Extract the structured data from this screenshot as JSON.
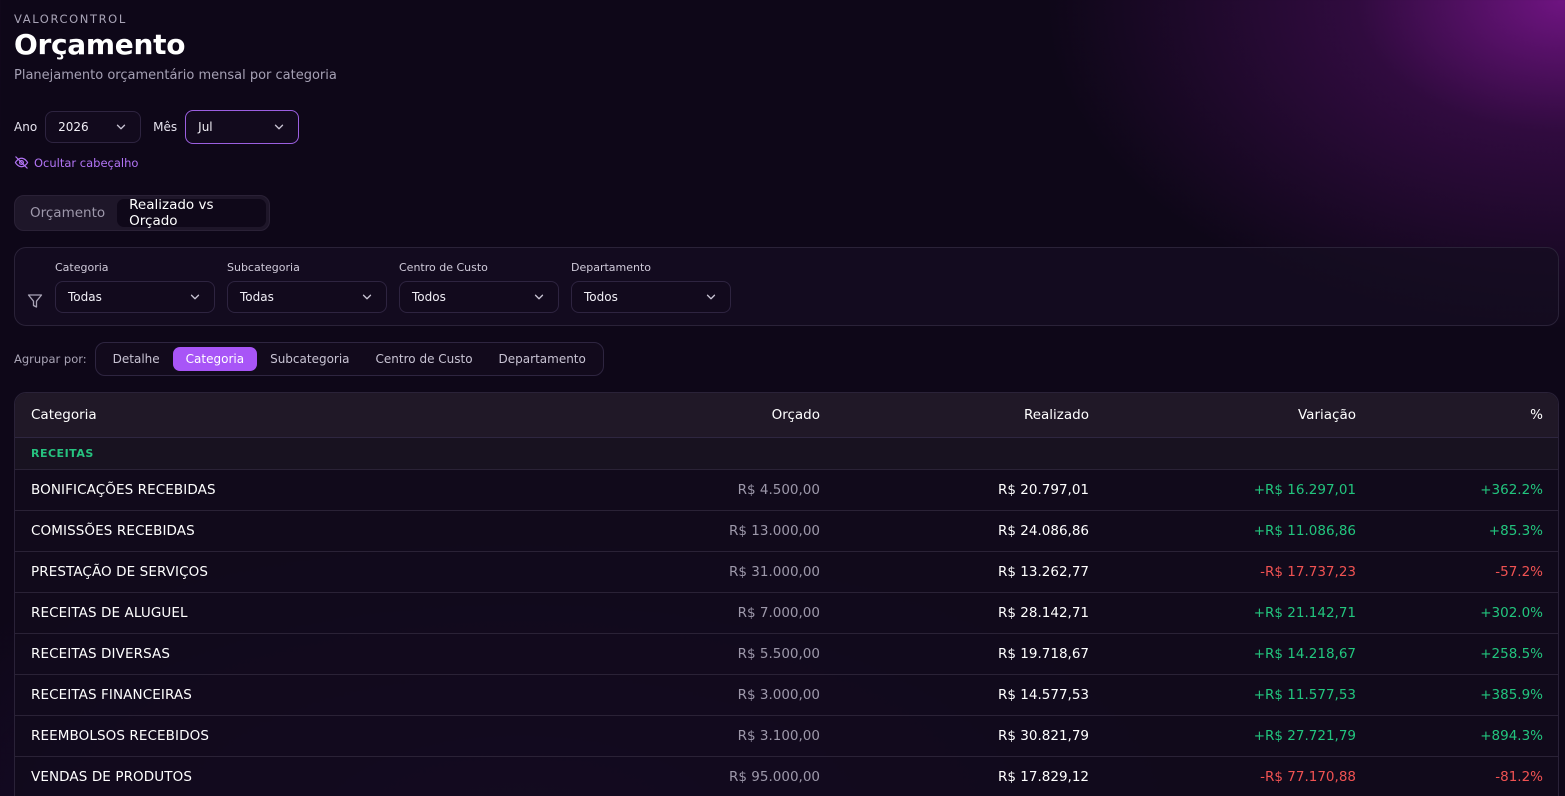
{
  "header": {
    "brand": "VALORCONTROL",
    "title": "Orçamento",
    "subtitle": "Planejamento orçamentário mensal por categoria"
  },
  "period": {
    "year_label": "Ano",
    "year_value": "2026",
    "month_label": "Mês",
    "month_value": "Jul"
  },
  "hide_header_label": "Ocultar cabeçalho",
  "tabs": [
    {
      "label": "Orçamento",
      "active": false
    },
    {
      "label": "Realizado vs Orçado",
      "active": true
    }
  ],
  "filters": [
    {
      "label": "Categoria",
      "value": "Todas"
    },
    {
      "label": "Subcategoria",
      "value": "Todas"
    },
    {
      "label": "Centro de Custo",
      "value": "Todos"
    },
    {
      "label": "Departamento",
      "value": "Todos"
    }
  ],
  "group_by": {
    "label": "Agrupar por:",
    "options": [
      {
        "label": "Detalhe",
        "active": false
      },
      {
        "label": "Categoria",
        "active": true
      },
      {
        "label": "Subcategoria",
        "active": false
      },
      {
        "label": "Centro de Custo",
        "active": false
      },
      {
        "label": "Departamento",
        "active": false
      }
    ]
  },
  "table": {
    "columns": [
      "Categoria",
      "Orçado",
      "Realizado",
      "Variação",
      "%"
    ],
    "group_label": "RECEITAS",
    "rows": [
      {
        "categoria": "BONIFICAÇÕES RECEBIDAS",
        "orcado": "R$ 4.500,00",
        "realizado": "R$ 20.797,01",
        "variacao": "+R$ 16.297,01",
        "pct": "+362.2%",
        "positive": true
      },
      {
        "categoria": "COMISSÕES RECEBIDAS",
        "orcado": "R$ 13.000,00",
        "realizado": "R$ 24.086,86",
        "variacao": "+R$ 11.086,86",
        "pct": "+85.3%",
        "positive": true
      },
      {
        "categoria": "PRESTAÇÃO DE SERVIÇOS",
        "orcado": "R$ 31.000,00",
        "realizado": "R$ 13.262,77",
        "variacao": "-R$ 17.737,23",
        "pct": "-57.2%",
        "positive": false
      },
      {
        "categoria": "RECEITAS DE ALUGUEL",
        "orcado": "R$ 7.000,00",
        "realizado": "R$ 28.142,71",
        "variacao": "+R$ 21.142,71",
        "pct": "+302.0%",
        "positive": true
      },
      {
        "categoria": "RECEITAS DIVERSAS",
        "orcado": "R$ 5.500,00",
        "realizado": "R$ 19.718,67",
        "variacao": "+R$ 14.218,67",
        "pct": "+258.5%",
        "positive": true
      },
      {
        "categoria": "RECEITAS FINANCEIRAS",
        "orcado": "R$ 3.000,00",
        "realizado": "R$ 14.577,53",
        "variacao": "+R$ 11.577,53",
        "pct": "+385.9%",
        "positive": true
      },
      {
        "categoria": "REEMBOLSOS RECEBIDOS",
        "orcado": "R$ 3.100,00",
        "realizado": "R$ 30.821,79",
        "variacao": "+R$ 27.721,79",
        "pct": "+894.3%",
        "positive": true
      },
      {
        "categoria": "VENDAS DE PRODUTOS",
        "orcado": "R$ 95.000,00",
        "realizado": "R$ 17.829,12",
        "variacao": "-R$ 77.170,88",
        "pct": "-81.2%",
        "positive": false
      }
    ]
  },
  "colors": {
    "accent": "#a855f7",
    "positive": "#22c57e",
    "negative": "#f05252",
    "group_label": "#26c27f"
  }
}
